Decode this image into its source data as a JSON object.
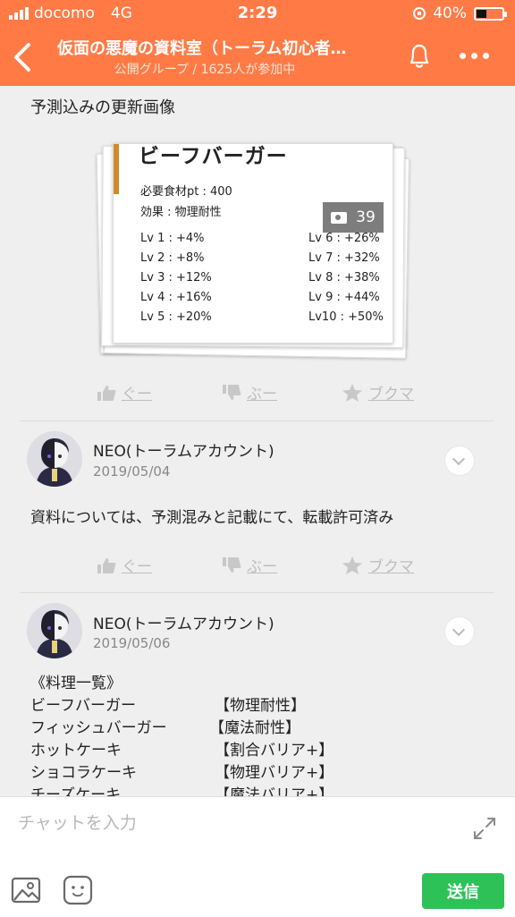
{
  "status_bar": {
    "carrier": "docomo",
    "network": "4G",
    "time": "2:29",
    "battery": "40%",
    "battery_level": 0.4
  },
  "header": {
    "back_icon": "chevron-left-icon",
    "title": "仮面の悪魔の資料室（トーラム初心者…",
    "subtitle": "公開グループ / 1625人が参加中",
    "bell_icon": "bell-icon",
    "more_icon": "more-dots-icon"
  },
  "post1": {
    "caption": "予測込みの更新画像",
    "image_card": {
      "title": "ビーフバーガー",
      "ingredient": "必要食材pt : 400",
      "effect": "効果 : 物理耐性",
      "levels_left": [
        "Lv 1 : +4%",
        "Lv 2 : +8%",
        "Lv 3 : +12%",
        "Lv 4 : +16%",
        "Lv 5 : +20%"
      ],
      "levels_right": [
        "Lv 6 : +26%",
        "Lv 7 : +32%",
        "Lv 8 : +38%",
        "Lv 9 : +44%",
        "Lv10 : +50%"
      ],
      "photo_count": "39"
    },
    "actions": {
      "good": "ぐー",
      "boo": "ぶー",
      "bookmark": "ブクマ"
    }
  },
  "post2": {
    "user": "NEO(トーラムアカウント)",
    "date": "2019/05/04",
    "text": "資料については、予測混みと記載にて、転載許可済み",
    "actions": {
      "good": "ぐー",
      "boo": "ぶー",
      "bookmark": "ブクマ"
    }
  },
  "post3": {
    "user": "NEO(トーラムアカウント)",
    "date": "2019/05/06",
    "heading": "《料理一覧》",
    "items": [
      {
        "name": "ビーフバーガー",
        "effect": "【物理耐性】"
      },
      {
        "name": "フィッシュバーガー",
        "effect": "【魔法耐性】"
      },
      {
        "name": "ホットケーキ",
        "effect": "【割合バリア+】"
      },
      {
        "name": "ショコラケーキ",
        "effect": "【物理バリア+】"
      },
      {
        "name": "チーズケーキ",
        "effect": "【魔法バリア+】"
      }
    ]
  },
  "composer": {
    "placeholder": "チャットを入力",
    "send_label": "送信",
    "expand_icon": "expand-icon",
    "image_icon": "image-icon",
    "sticker_icon": "sticker-icon"
  },
  "colors": {
    "header": "#ff7a45",
    "send": "#2ec157",
    "action_gray": "#bdbdbd"
  }
}
